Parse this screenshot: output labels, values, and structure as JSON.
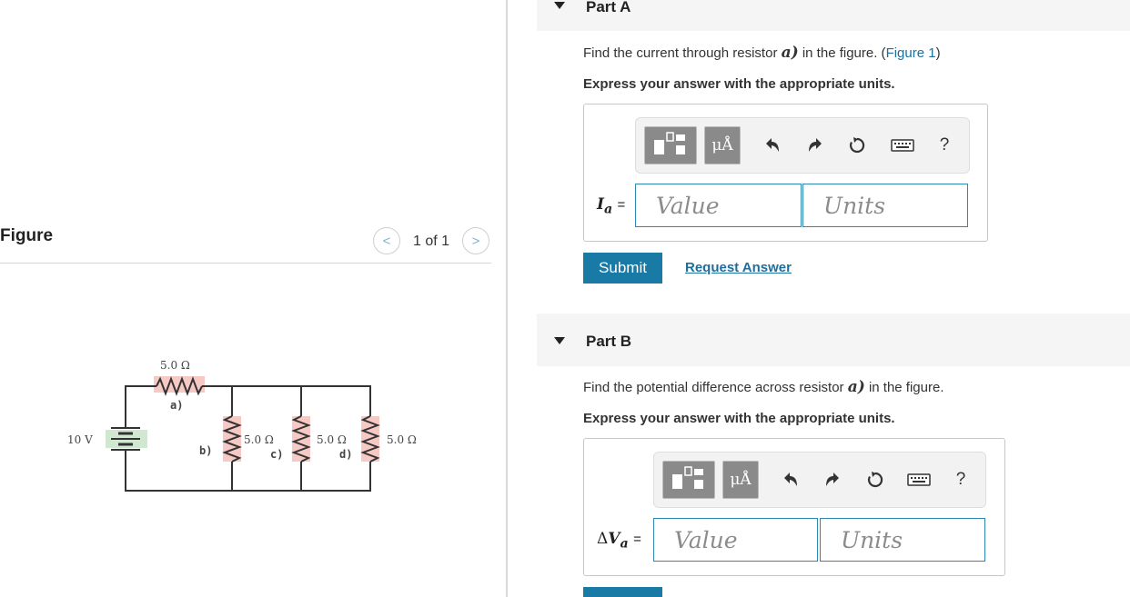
{
  "figure": {
    "title": "Figure",
    "page_indicator": "1 of 1",
    "prev_glyph": "<",
    "next_glyph": ">"
  },
  "circuit": {
    "battery_label": "10 V",
    "resistor_a_value": "5.0 Ω",
    "resistor_a_tag": "a)",
    "resistor_b_value": "5.0 Ω",
    "resistor_b_tag": "b)",
    "resistor_c_value": "5.0 Ω",
    "resistor_c_tag": "c)",
    "resistor_d_value": "5.0 Ω",
    "resistor_d_tag": "d)"
  },
  "partA": {
    "title": "Part A",
    "question_prefix": "Find the current through resistor ",
    "question_var": "a)",
    "question_suffix": " in the figure. (",
    "figure_link": "Figure 1",
    "question_close": ")",
    "instruction": "Express your answer with the appropriate units.",
    "unit_button": "μÅ",
    "help": "?",
    "var_symbol": "I",
    "var_subscript": "a",
    "equals": "=",
    "value_placeholder": "Value",
    "units_placeholder": "Units",
    "submit": "Submit",
    "request_answer": "Request Answer"
  },
  "partB": {
    "title": "Part B",
    "question_prefix": "Find the potential difference across resistor ",
    "question_var": "a)",
    "question_suffix": " in the figure.",
    "instruction": "Express your answer with the appropriate units.",
    "unit_button": "μÅ",
    "help": "?",
    "var_delta": "Δ",
    "var_symbol": "V",
    "var_subscript": "a",
    "equals": "=",
    "value_placeholder": "Value",
    "units_placeholder": "Units"
  },
  "colors": {
    "accent": "#1a7aa6",
    "link": "#1e6e9e",
    "resistor_highlight": "#f6c9c4",
    "battery_highlight": "#cfe8cf"
  }
}
